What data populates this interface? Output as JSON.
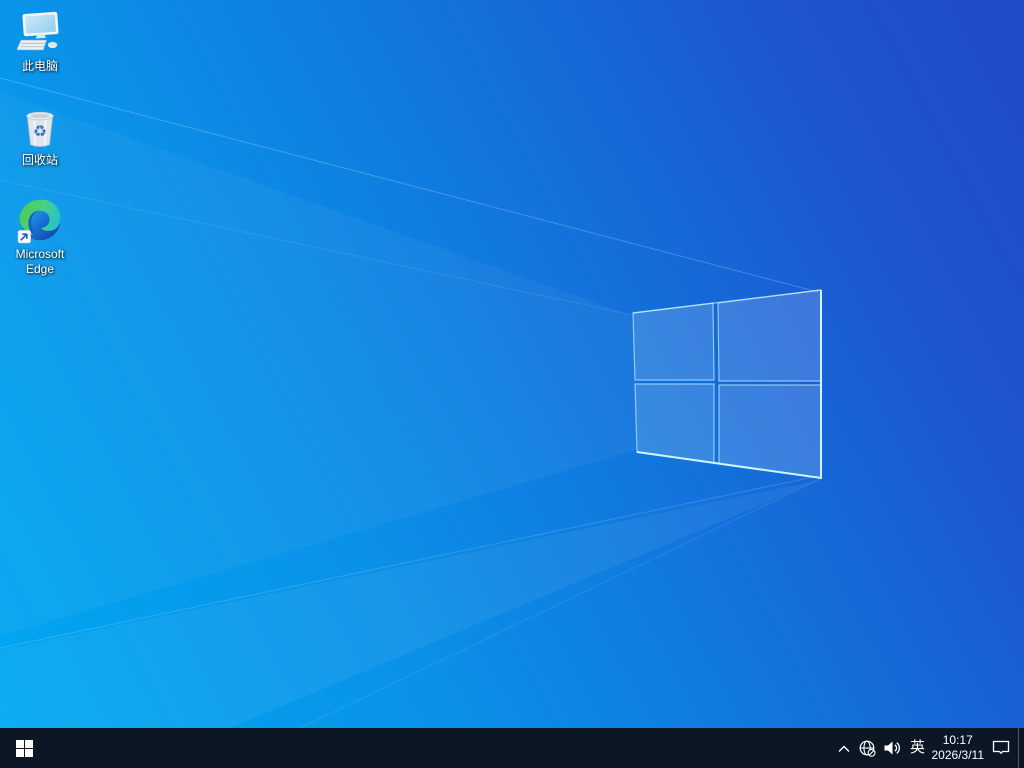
{
  "desktop": {
    "icons": [
      {
        "id": "this-pc",
        "label": "此电脑",
        "icon": "computer-monitor-keyboard"
      },
      {
        "id": "recycle-bin",
        "label": "回收站",
        "icon": "recycle-bin"
      },
      {
        "id": "microsoft-edge",
        "label": "Microsoft Edge",
        "icon": "edge-browser-swirl",
        "badge": "shortcut-arrow"
      }
    ]
  },
  "taskbar": {
    "start": {
      "icon": "windows-logo"
    },
    "tray": {
      "hidden_icons": {
        "icon": "chevron-up"
      },
      "network": {
        "icon": "globe-no-internet"
      },
      "volume": {
        "icon": "speaker-sound-waves"
      },
      "ime": "英",
      "time": "10:17",
      "date": "2026/3/11",
      "action_center": {
        "icon": "comment-bubble"
      }
    }
  },
  "colors": {
    "wallpaper_bright": "#00a9f2",
    "wallpaper_deep": "#1d4fcb",
    "logo_glow": "#bef3ff",
    "taskbar_bg": "#0c1726",
    "icon_label_text": "#ffffff"
  }
}
